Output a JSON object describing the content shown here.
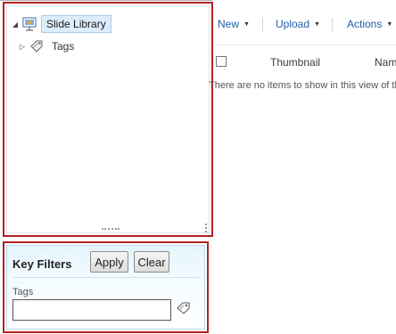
{
  "tree": {
    "root_label": "Slide Library",
    "child_label": "Tags"
  },
  "filters": {
    "title": "Key Filters",
    "apply_label": "Apply",
    "clear_label": "Clear",
    "tags_label": "Tags",
    "tags_value": ""
  },
  "toolbar": {
    "new_label": "New",
    "upload_label": "Upload",
    "actions_label": "Actions"
  },
  "list": {
    "columns": [
      "Thumbnail",
      "Nam"
    ],
    "empty_message": "There are no items to show in this view of th"
  },
  "icons": {
    "root": "slide-library-icon",
    "child": "tags-icon",
    "tag_picker": "tag-picker-icon",
    "expander_root": "expanded-triangle-icon",
    "expander_child": "collapsed-triangle-icon"
  }
}
